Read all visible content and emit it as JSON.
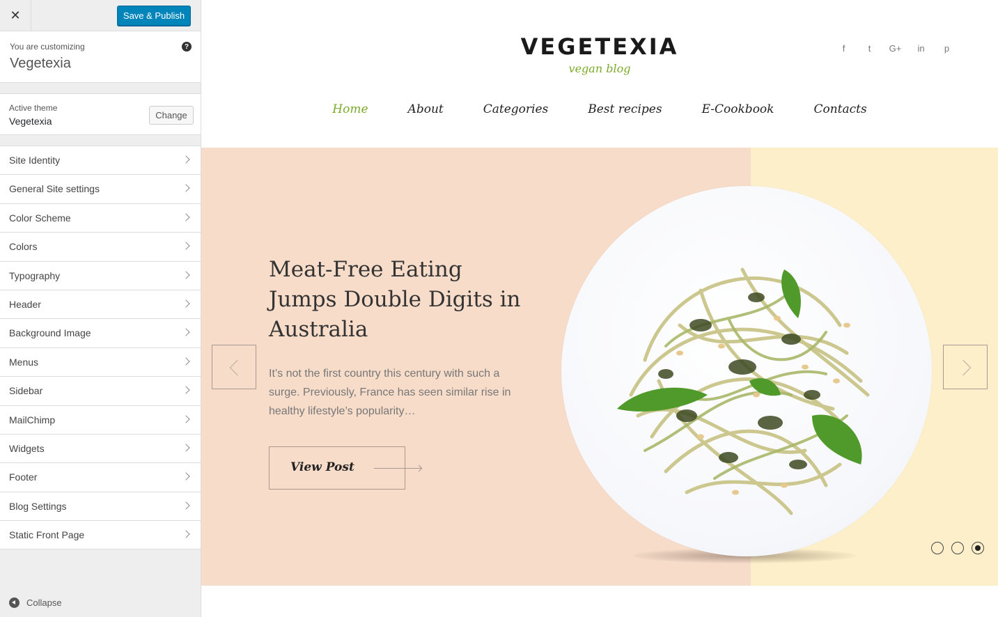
{
  "topbar": {
    "close_glyph": "✕",
    "close_icon": "close-icon",
    "publish_label": "Save & Publish"
  },
  "info": {
    "label": "You are customizing",
    "title": "Vegetexia",
    "help_glyph": "?"
  },
  "theme": {
    "label": "Active theme",
    "name": "Vegetexia",
    "change_label": "Change"
  },
  "sections": [
    "Site Identity",
    "General Site settings",
    "Color Scheme",
    "Colors",
    "Typography",
    "Header",
    "Background Image",
    "Menus",
    "Sidebar",
    "MailChimp",
    "Widgets",
    "Footer",
    "Blog Settings",
    "Static Front Page"
  ],
  "collapse_label": "Collapse",
  "site": {
    "logo": "VEGETEXIA",
    "tagline": "vegan blog",
    "social": [
      {
        "icon": "facebook-icon",
        "glyph": "f"
      },
      {
        "icon": "twitter-icon",
        "glyph": "t"
      },
      {
        "icon": "google-plus-icon",
        "glyph": "G+"
      },
      {
        "icon": "linkedin-icon",
        "glyph": "in"
      },
      {
        "icon": "pinterest-icon",
        "glyph": "p"
      }
    ],
    "nav": [
      "Home",
      "About",
      "Categories",
      "Best recipes",
      "E-Cookbook",
      "Contacts"
    ],
    "nav_active": "Home"
  },
  "slide": {
    "headline": "Meat-Free Eating Jumps Double Digits in Australia",
    "excerpt": "It’s not the first country this century with such a surge. Previously, France has seen similar rise in healthy lifestyle’s popularity…",
    "button_label": "View Post",
    "dots_count": 3,
    "active_dot": 3
  },
  "colors": {
    "accent": "#7bab2a",
    "publish_button": "#0085ba",
    "slider_left_bg": "#f7dcca",
    "slider_right_bg": "#fcefc9"
  }
}
